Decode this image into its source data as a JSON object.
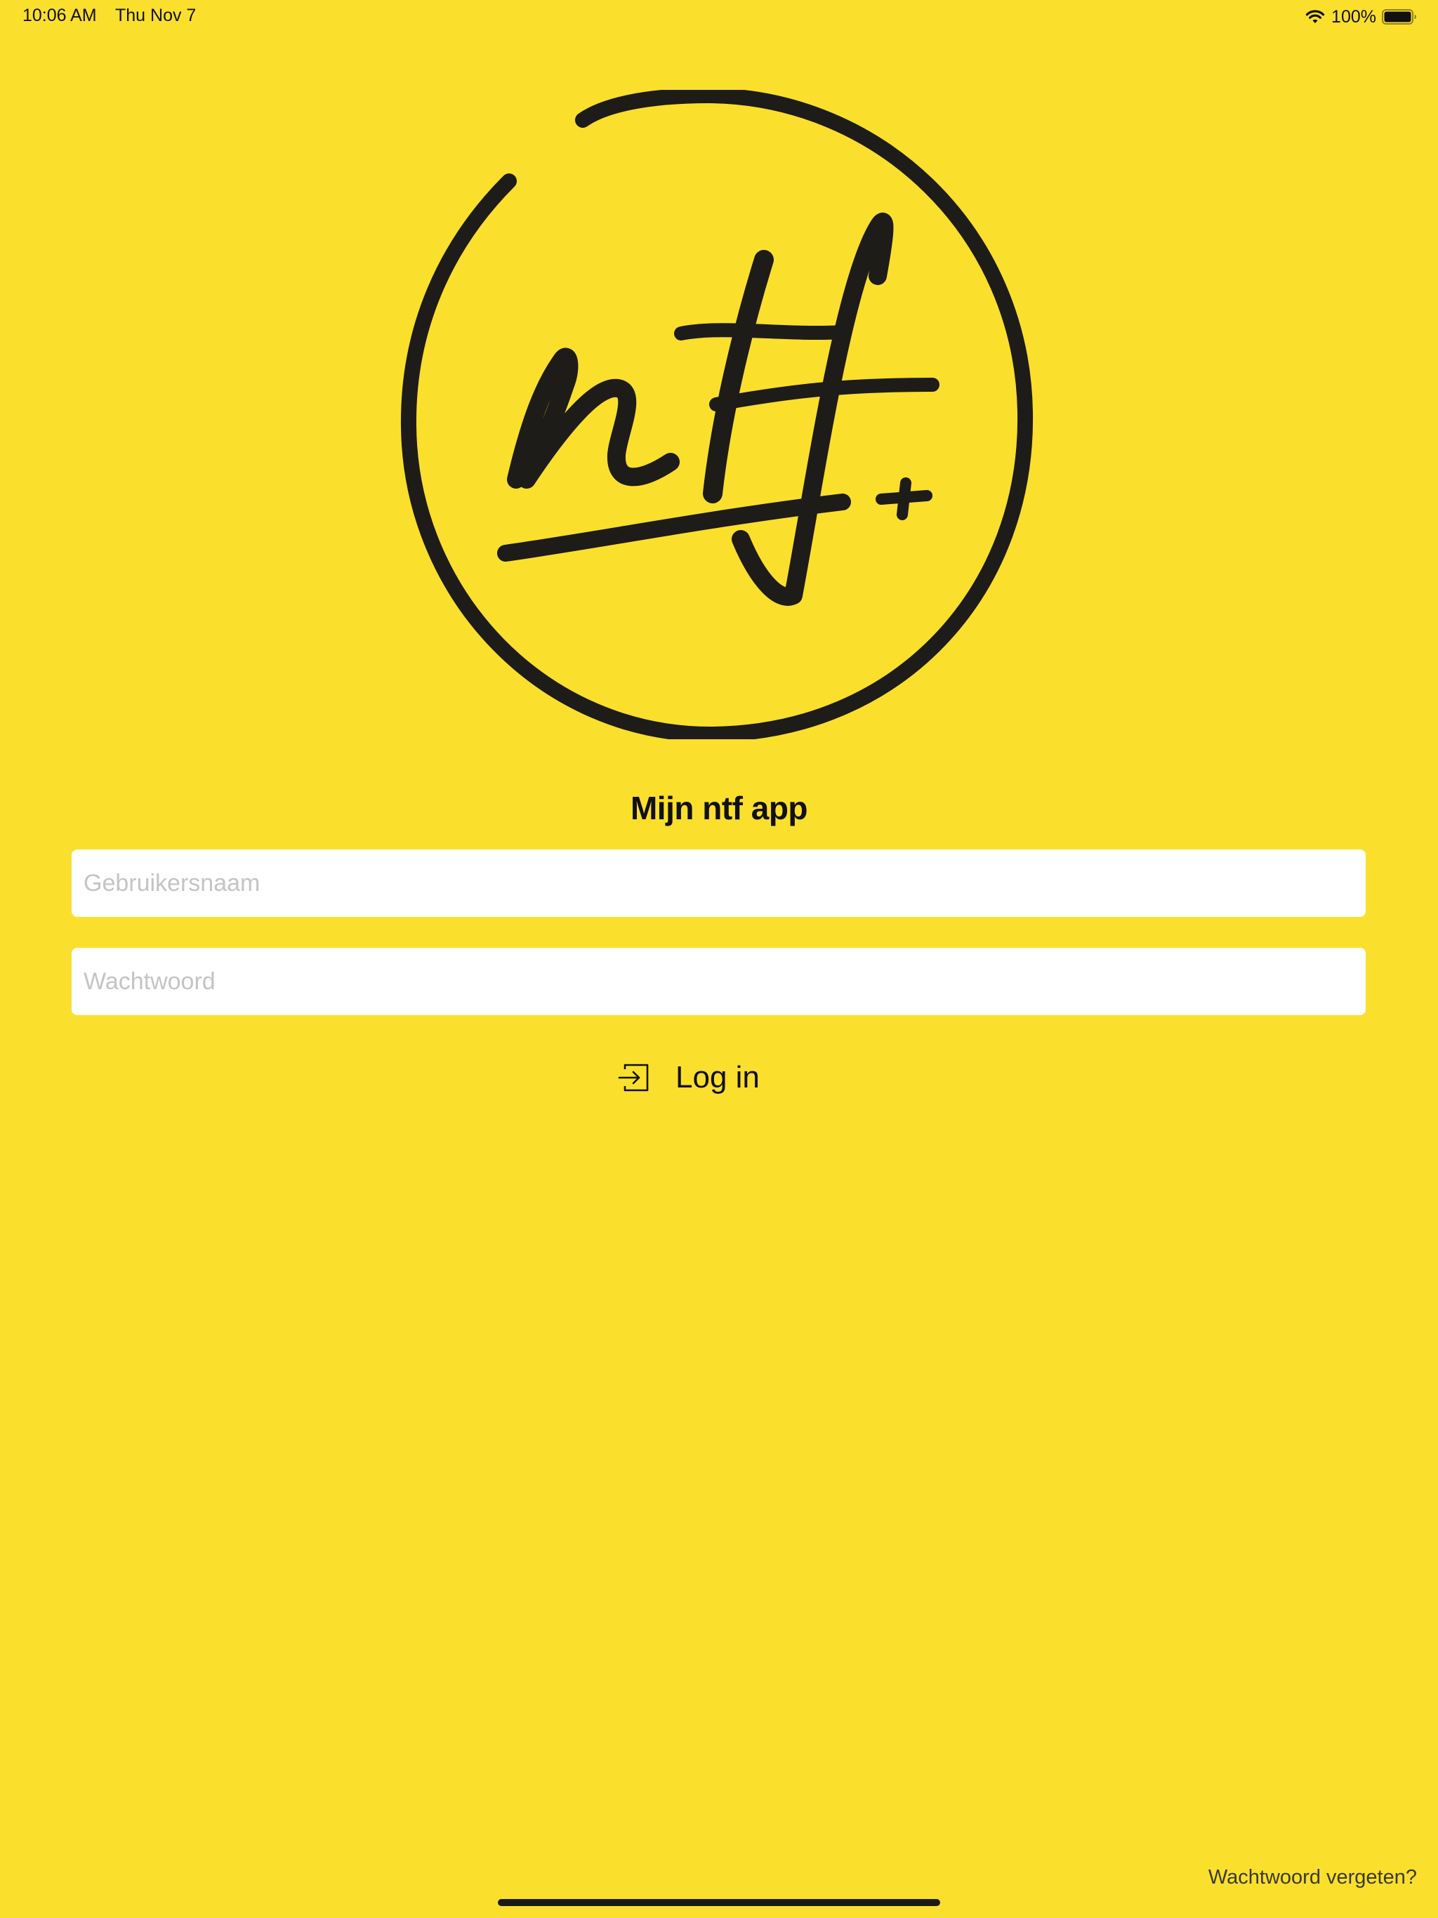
{
  "status_bar": {
    "time": "10:06 AM",
    "date": "Thu Nov 7",
    "battery_percent": "100%",
    "wifi_icon": "wifi-icon",
    "battery_icon": "battery-icon"
  },
  "logo": {
    "text": "ntf+",
    "icon": "ntf-logo"
  },
  "title": "Mijn ntf app",
  "form": {
    "username": {
      "placeholder": "Gebruikersnaam",
      "value": ""
    },
    "password": {
      "placeholder": "Wachtwoord",
      "value": ""
    },
    "login_label": "Log in",
    "login_icon": "login-arrow-icon"
  },
  "forgot_password_label": "Wachtwoord vergeten?",
  "colors": {
    "background": "#FBDF2D",
    "text": "#111111",
    "field_background": "#FFFFFF",
    "placeholder": "#C4C4C7"
  }
}
